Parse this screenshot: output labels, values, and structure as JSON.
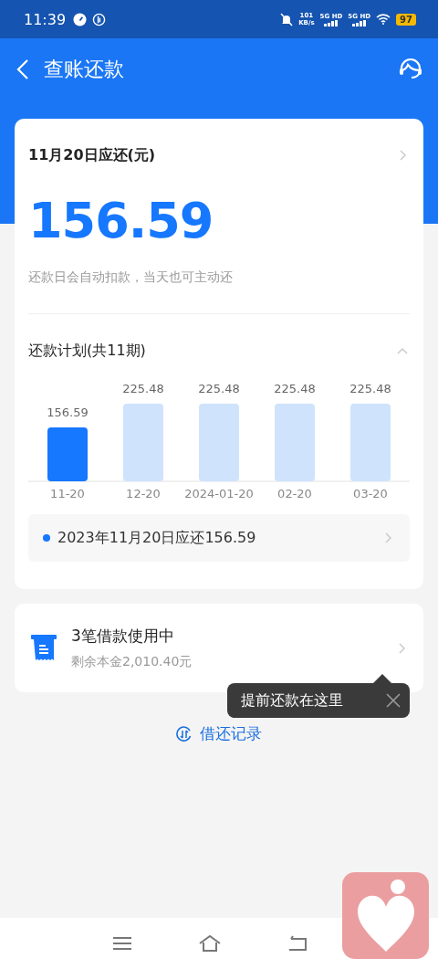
{
  "status_bar": {
    "time": "11:39",
    "speed_value": "101",
    "speed_unit": "KB/s",
    "networks": [
      "5G HD",
      "5G HD"
    ],
    "battery": "97"
  },
  "header": {
    "title": "查账还款"
  },
  "bill": {
    "title": "11月20日应还(元)",
    "amount": "156.59",
    "note": "还款日会自动扣款，当天也可主动还"
  },
  "plan": {
    "title": "还款计划(共11期)",
    "expanded": true,
    "chart_data": {
      "type": "bar",
      "categories": [
        "11-20",
        "12-20",
        "2024-01-20",
        "02-20",
        "03-20"
      ],
      "series": [
        {
          "color": "#1677ff",
          "values": [
            156.59,
            null,
            null,
            null,
            null
          ]
        },
        {
          "color": "#cfe3fc",
          "values": [
            null,
            225.48,
            225.48,
            225.48,
            225.48
          ]
        }
      ],
      "data_labels": true
    },
    "detail": {
      "text": "2023年11月20日应还156.59",
      "color": "#1677ff"
    }
  },
  "loans": {
    "title": "3笔借款使用中",
    "subtitle": "剩余本金2,010.40元"
  },
  "tooltip": {
    "text": "提前还款在这里"
  },
  "history_link": {
    "label": "借还记录"
  }
}
